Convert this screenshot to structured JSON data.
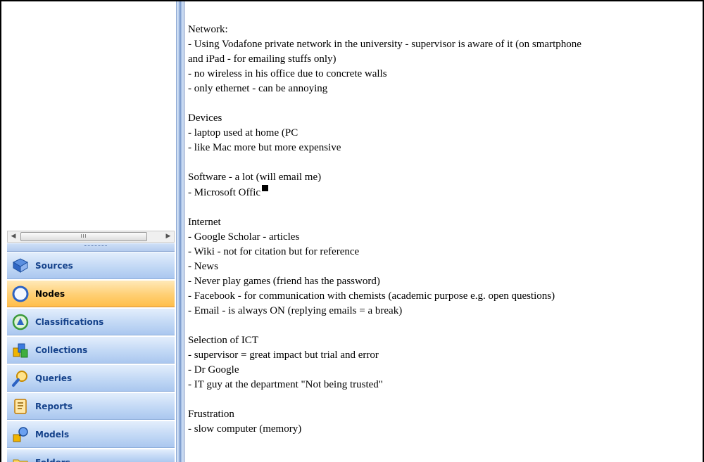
{
  "colors": {
    "nav_label": "#15428b",
    "active_nav": "#ffcf73",
    "nav_bg": "#c2d8f5",
    "splitter": "#6e8fc4"
  },
  "scrollbar": {
    "left_arrow": "◀",
    "right_arrow": "▶",
    "thumb_grip": "III"
  },
  "nav": {
    "items": [
      {
        "label": "Sources",
        "icon": "book-icon"
      },
      {
        "label": "Nodes",
        "icon": "circle-node-icon",
        "active": true
      },
      {
        "label": "Classifications",
        "icon": "classification-icon"
      },
      {
        "label": "Collections",
        "icon": "collections-icon"
      },
      {
        "label": "Queries",
        "icon": "magnifier-icon"
      },
      {
        "label": "Reports",
        "icon": "report-icon"
      },
      {
        "label": "Models",
        "icon": "models-icon"
      },
      {
        "label": "Folders",
        "icon": "folder-icon"
      }
    ]
  },
  "document": {
    "network": {
      "heading": "Network:",
      "lines": [
        "- Using Vodafone private network in the university - supervisor is aware of it (on smartphone",
        "and iPad - for emailing stuffs only)",
        "- no wireless in his office due to concrete walls",
        "- only ethernet - can be annoying"
      ]
    },
    "devices": {
      "heading": "Devices",
      "lines": [
        "- laptop used at home (PC",
        "- like Mac more but more expensive"
      ]
    },
    "software": {
      "heading": "Software - a lot (will email me)",
      "lines": [
        "- Microsoft Offic"
      ]
    },
    "internet": {
      "heading": "Internet",
      "lines": [
        "- Google Scholar - articles",
        "- Wiki - not for citation but for reference",
        "- News",
        "- Never play games (friend has the password)",
        "- Facebook - for communication with chemists (academic purpose e.g. open questions)",
        "- Email - is always ON (replying emails = a break)"
      ]
    },
    "selection": {
      "heading": "Selection of ICT",
      "lines": [
        "- supervisor = great impact but trial and error",
        "- Dr Google",
        "- IT guy at the department \"Not being trusted\""
      ]
    },
    "frustration": {
      "heading": "Frustration",
      "lines": [
        "- slow computer (memory)"
      ]
    }
  }
}
